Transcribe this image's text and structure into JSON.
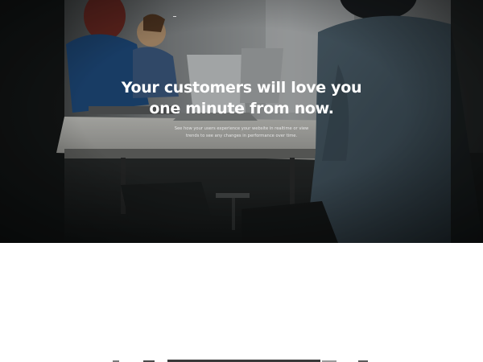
{
  "hero": {
    "headline_line1": "Your customers will love you",
    "headline_line2": "one minute from now.",
    "sub_line1": "See how your users experience your website in realtime or view",
    "sub_line2": "trends to see any changes in performance over time."
  },
  "colors": {
    "hero_dark": "#1c1f1f",
    "headline": "#ffffff",
    "page_background": "#ffffff"
  }
}
